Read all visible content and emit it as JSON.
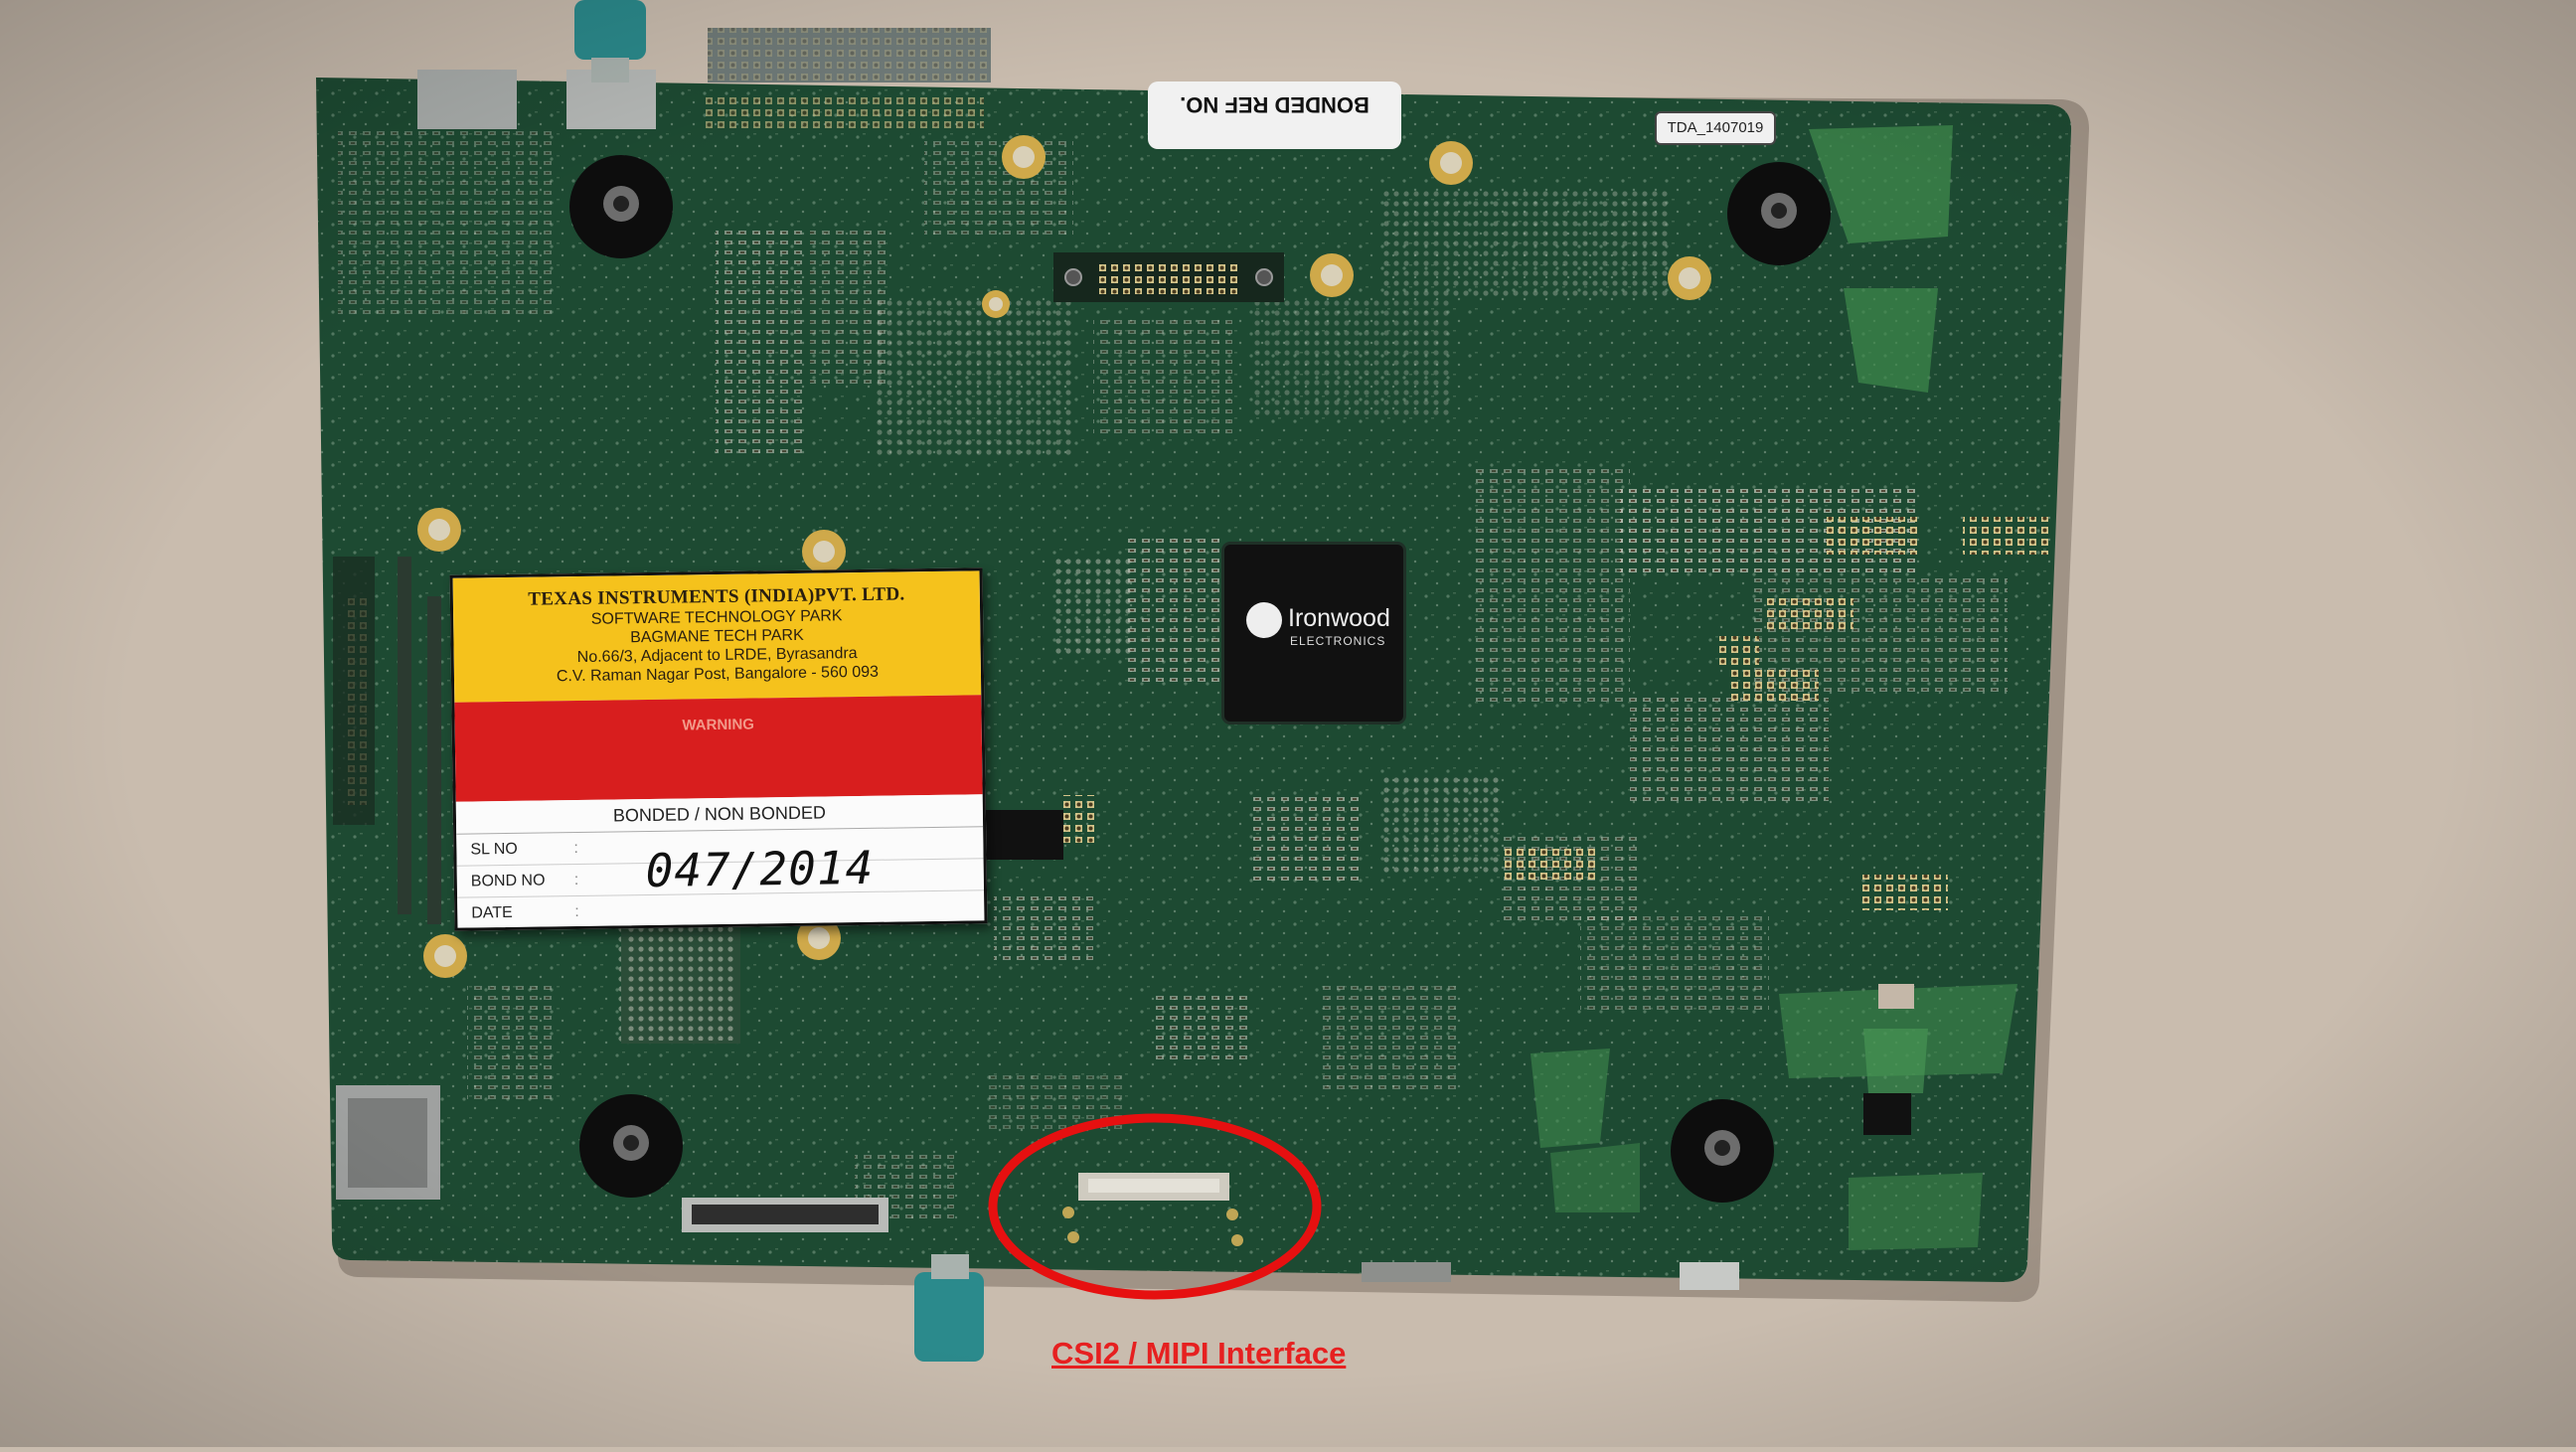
{
  "image": {
    "subject": "Printed circuit board",
    "colors": {
      "background_wall": "#c9bcae",
      "board": "#1d4a32",
      "annotation_red": "#e62020",
      "sticker_yellow": "#f5c21c",
      "sticker_red": "#d81e1e"
    }
  },
  "sticker": {
    "company": "TEXAS INSTRUMENTS (INDIA)PVT. LTD.",
    "lines": [
      "SOFTWARE TECHNOLOGY PARK",
      "BAGMANE TECH PARK",
      "No.66/3, Adjacent to LRDE, Byrasandra",
      "C.V. Raman Nagar Post, Bangalore - 560 093"
    ],
    "warning_title": "WARNING",
    "bonded_header": "BONDED / NON BONDED",
    "fields": [
      {
        "label": "SL NO",
        "colon": ":",
        "value": ""
      },
      {
        "label": "BOND NO",
        "colon": ":",
        "value": "047/2014"
      },
      {
        "label": "DATE",
        "colon": ":",
        "value": ""
      }
    ]
  },
  "board_labels": {
    "bonded_ref": "BONDED REF NO.",
    "tda_id": "TDA_1407019",
    "chip_brand": "Ironwood",
    "chip_sub": "ELECTRONICS"
  },
  "annotation": {
    "caption": "CSI2 / MIPI Interface",
    "highlight_shape": "ellipse"
  }
}
